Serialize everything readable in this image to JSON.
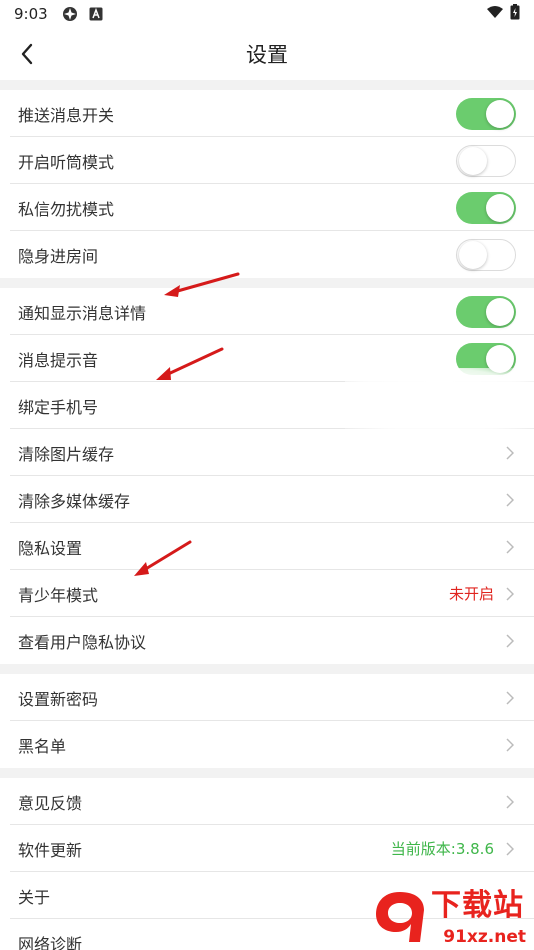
{
  "status_bar": {
    "time": "9:03"
  },
  "header": {
    "title": "设置"
  },
  "groups": [
    {
      "items": [
        {
          "label": "推送消息开关",
          "toggle": "on"
        },
        {
          "label": "开启听筒模式",
          "toggle": "off"
        },
        {
          "label": "私信勿扰模式",
          "toggle": "on"
        },
        {
          "label": "隐身进房间",
          "toggle": "off"
        }
      ]
    },
    {
      "items": [
        {
          "label": "通知显示消息详情",
          "toggle": "on"
        },
        {
          "label": "消息提示音",
          "toggle": "on"
        },
        {
          "label": "绑定手机号"
        },
        {
          "label": "清除图片缓存"
        },
        {
          "label": "清除多媒体缓存"
        },
        {
          "label": "隐私设置"
        },
        {
          "label": "青少年模式",
          "value": "未开启"
        },
        {
          "label": "查看用户隐私协议"
        }
      ]
    },
    {
      "items": [
        {
          "label": "设置新密码"
        },
        {
          "label": "黑名单"
        }
      ]
    },
    {
      "items": [
        {
          "label": "意见反馈"
        },
        {
          "label": "软件更新",
          "value": "当前版本:3.8.6"
        },
        {
          "label": "关于"
        },
        {
          "label": "网络诊断"
        }
      ]
    }
  ],
  "watermark": {
    "text": "下载站",
    "sub": "91xz.net"
  },
  "colors": {
    "toggle_on": "#6bcc6e",
    "value_red": "#e0251f",
    "value_green": "#3fb64a",
    "annotation_arrow": "#d51a1a"
  }
}
